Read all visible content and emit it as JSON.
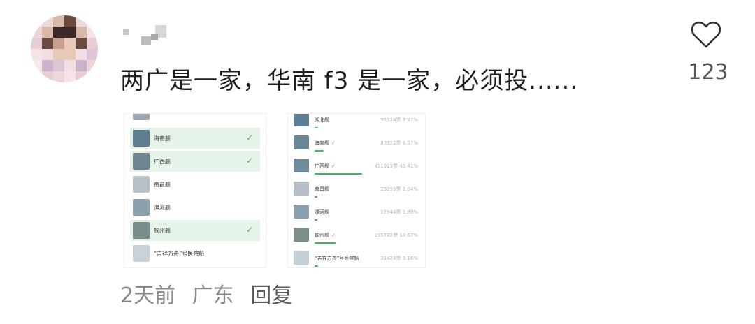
{
  "comment": {
    "text": "两广是一家，华南 f3 是一家，必须投......",
    "likes": "123",
    "time": "2天前",
    "location": "广东",
    "reply_label": "回复"
  },
  "poll_options": [
    {
      "label": "海南舰",
      "selected": true
    },
    {
      "label": "广西舰",
      "selected": true
    },
    {
      "label": "南昌舰",
      "selected": false
    },
    {
      "label": "漯河舰",
      "selected": false
    },
    {
      "label": "钦州舰",
      "selected": true
    },
    {
      "label": "“吉祥方舟”号医院船",
      "selected": false
    }
  ],
  "poll_results": [
    {
      "label": "湖北舰",
      "voted": false,
      "votes": "32524票",
      "percent": "3.37%",
      "share": 0.0337
    },
    {
      "label": "海南舰",
      "voted": true,
      "votes": "85322票",
      "percent": "8.57%",
      "share": 0.0857
    },
    {
      "label": "广西舰",
      "voted": true,
      "votes": "451915票",
      "percent": "45.41%",
      "share": 0.4541
    },
    {
      "label": "南昌舰",
      "voted": false,
      "votes": "23253票",
      "percent": "2.04%",
      "share": 0.0204
    },
    {
      "label": "漯河舰",
      "voted": false,
      "votes": "17944票",
      "percent": "1.80%",
      "share": 0.018
    },
    {
      "label": "钦州舰",
      "voted": true,
      "votes": "195782票",
      "percent": "19.67%",
      "share": 0.1967
    },
    {
      "label": "“吉祥方舟”号医院船",
      "voted": false,
      "votes": "31428票",
      "percent": "3.16%",
      "share": 0.0316
    }
  ],
  "icons": {
    "like": "heart-outline-icon",
    "check": "check-icon"
  }
}
